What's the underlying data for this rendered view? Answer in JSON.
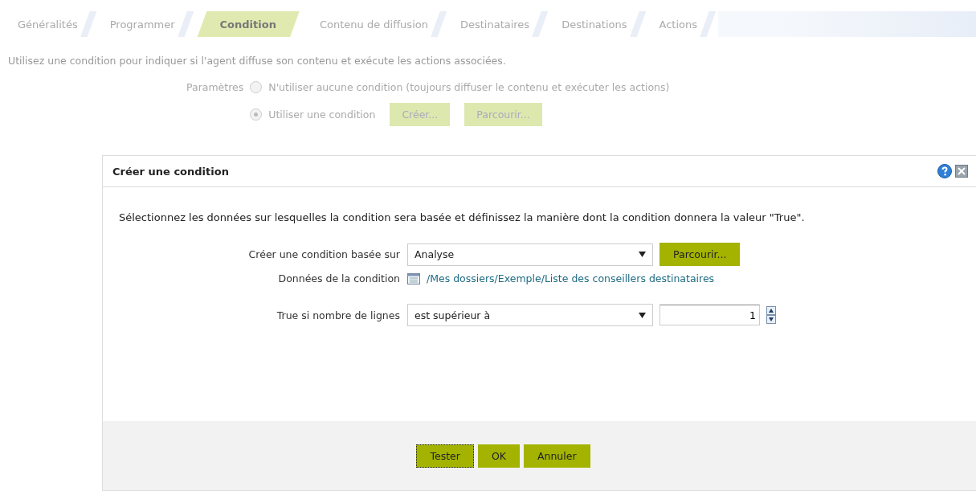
{
  "tabs": [
    {
      "label": "Généralités",
      "selected": false
    },
    {
      "label": "Programmer",
      "selected": false
    },
    {
      "label": "Condition",
      "selected": true
    },
    {
      "label": "Contenu de diffusion",
      "selected": false
    },
    {
      "label": "Destinataires",
      "selected": false
    },
    {
      "label": "Destinations",
      "selected": false
    },
    {
      "label": "Actions",
      "selected": false
    }
  ],
  "intro": "Utilisez une condition pour indiquer si l'agent diffuse son contenu et exécute les actions associées.",
  "settings": {
    "label": "Paramètres",
    "options": [
      {
        "label": "N'utiliser aucune condition (toujours diffuser le contenu et exécuter les actions)",
        "selected": false
      },
      {
        "label": "Utiliser une condition",
        "selected": true,
        "buttons": [
          "Créer...",
          "Parcourir..."
        ]
      }
    ]
  },
  "dialog": {
    "title": "Créer une condition",
    "description": "Sélectionnez les données sur lesquelles la condition sera basée et définissez la manière dont la condition donnera la valeur \"True\".",
    "based_on": {
      "label": "Créer une condition basée sur",
      "value": "Analyse",
      "button": "Parcourir..."
    },
    "data": {
      "label": "Données de la condition",
      "link": "/Mes dossiers/Exemple/Liste des conseillers destinataires"
    },
    "rows_condition": {
      "label": "True si nombre de lignes",
      "value": "est supérieur à",
      "number": "1"
    },
    "buttons": [
      {
        "label": "Tester",
        "focused": true
      },
      {
        "label": "OK",
        "focused": false
      },
      {
        "label": "Annuler",
        "focused": false
      }
    ]
  }
}
